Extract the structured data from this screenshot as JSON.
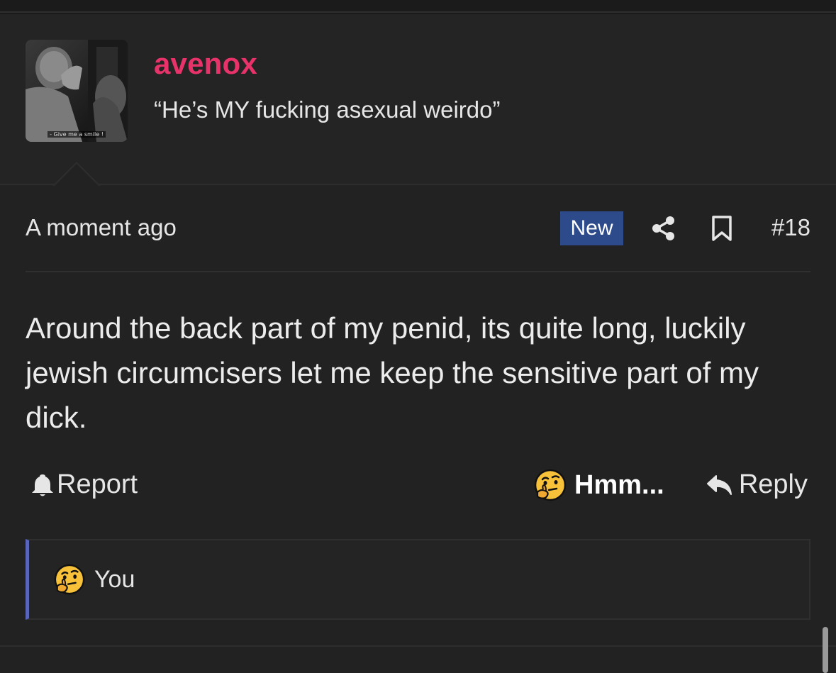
{
  "user": {
    "name": "avenox",
    "title": "“He’s MY fucking asexual weirdo”",
    "avatar_caption": "- Give me a smile !"
  },
  "post": {
    "timestamp": "A moment ago",
    "badge": "New",
    "number": "#18",
    "body": "Around the back part of my penid, its quite long, luckily jewish circumcisers let me keep the sensitive part of my dick."
  },
  "actions": {
    "report_label": "Report",
    "reaction_label": "Hmm...",
    "reply_label": "Reply"
  },
  "reactions": {
    "user": "You"
  },
  "colors": {
    "username": "#e8336a",
    "badge_bg": "#2d4a8a",
    "reaction_accent": "#5865b8"
  },
  "icons": {
    "share": "share-icon",
    "bookmark": "bookmark-icon",
    "report": "bell-icon",
    "reaction": "thinking-face-emoji",
    "reply": "reply-arrow-icon"
  }
}
